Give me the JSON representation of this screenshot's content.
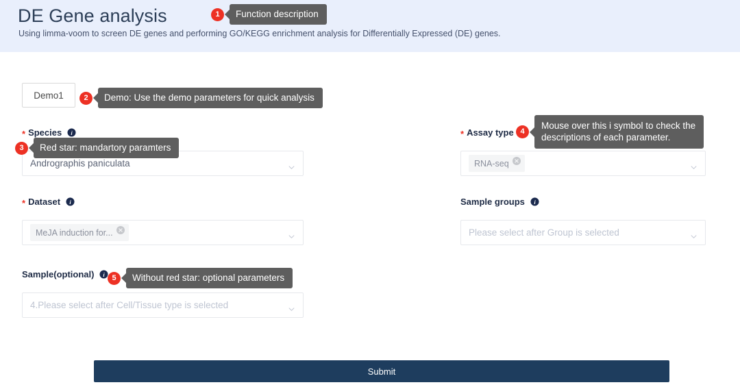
{
  "header": {
    "title": "DE Gene analysis",
    "subtitle": "Using limma-voom to screen DE genes and performing GO/KEGG enrichment analysis for Differentially Expressed (DE) genes."
  },
  "callouts": [
    {
      "number": "1",
      "text": "Function description"
    },
    {
      "number": "2",
      "text": "Demo: Use the demo parameters for quick analysis"
    },
    {
      "number": "3",
      "text": "Red star: mandartory paramters"
    },
    {
      "number": "4",
      "text": "Mouse over this i symbol to check the\ndescriptions of each parameter."
    },
    {
      "number": "5",
      "text": "Without red star: optional parameters"
    }
  ],
  "toolbar": {
    "demo_label": "Demo1"
  },
  "fields": {
    "species": {
      "label": "Species",
      "required_marker": "*",
      "value": "Androgaphis paniculata",
      "value_display": "Andrographis paniculata",
      "info_icon": "info-icon",
      "caret_icon": "chevron-down-icon"
    },
    "dataset": {
      "label": "Dataset",
      "required_marker": "*",
      "chip_label": "MeJA induction for...",
      "chip_close_icon": "close-circle-icon",
      "info_icon": "info-icon",
      "caret_icon": "chevron-down-icon"
    },
    "sample": {
      "label": "Sample(optional)",
      "placeholder": "4.Please select after Cell/Tissue type is selected",
      "info_icon": "info-icon",
      "caret_icon": "chevron-down-icon"
    },
    "assay_type": {
      "label": "Assay type",
      "required_marker": "*",
      "chip_label": "RNA-seq",
      "chip_close_icon": "close-circle-icon",
      "info_icon": "info-icon",
      "caret_icon": "chevron-down-icon"
    },
    "sample_groups": {
      "label": "Sample groups",
      "placeholder": "Please select after Group is selected",
      "info_icon": "info-icon",
      "caret_icon": "chevron-down-icon"
    }
  },
  "submit": {
    "label": "Submit"
  },
  "colors": {
    "header_band": "#e9effc",
    "title": "#2c3e57",
    "badge_red": "#ed3124",
    "tooltip_gray": "#5e5e5e",
    "submit_navy": "#1e3d5e",
    "info_navy": "#1b2a4e"
  }
}
